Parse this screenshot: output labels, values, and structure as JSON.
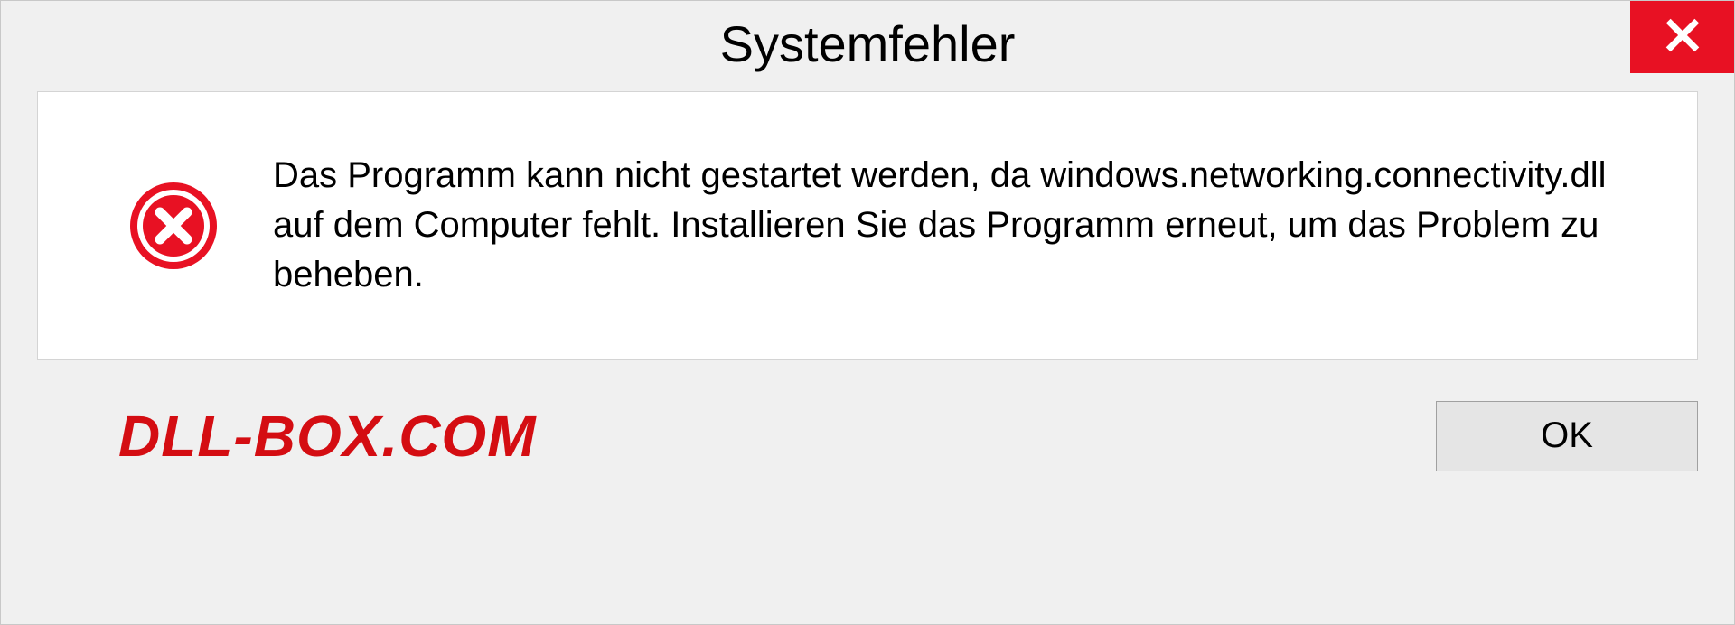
{
  "dialog": {
    "title": "Systemfehler",
    "message": "Das Programm kann nicht gestartet werden, da windows.networking.connectivity.dll auf dem Computer fehlt. Installieren Sie das Programm erneut, um das Problem zu beheben.",
    "ok_label": "OK"
  },
  "watermark": {
    "text": "DLL-BOX.COM"
  },
  "colors": {
    "close_bg": "#e81123",
    "error_icon": "#e81123",
    "watermark": "#d40d12"
  }
}
